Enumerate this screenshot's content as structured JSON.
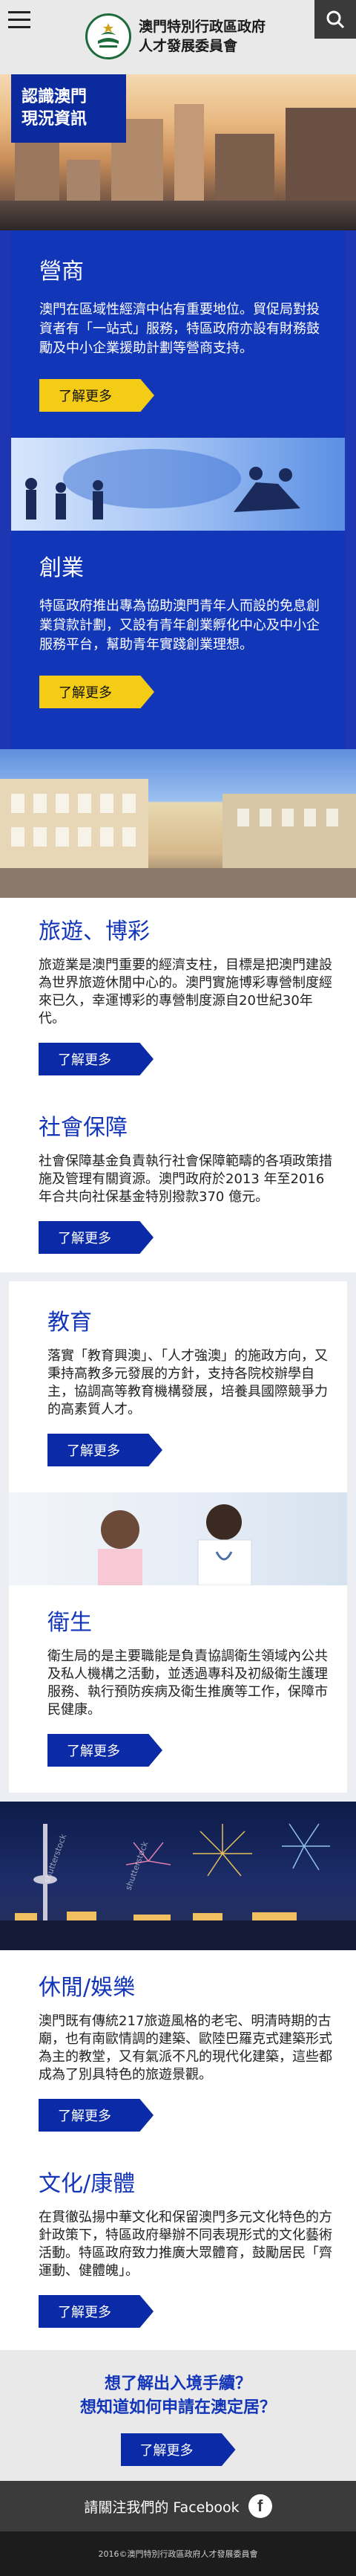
{
  "header": {
    "title_line1": "澳門特別行政區政府",
    "title_line2": "人才發展委員會"
  },
  "hero": {
    "label_line1": "認識澳門",
    "label_line2": "現況資訊"
  },
  "blue_sections": [
    {
      "title": "營商",
      "text": "澳門在區域性經濟中佔有重要地位。貿促局對投資者有「一站式」服務，特區政府亦設有財務鼓勵及中小企業援助計劃等營商支持。",
      "button": "了解更多"
    },
    {
      "title": "創業",
      "text": "特區政府推出專為協助澳門青年人而設的免息創業貸款計劃，又設有青年創業孵化中心及中小企服務平台，幫助青年實踐創業理想。",
      "button": "了解更多"
    }
  ],
  "white_sections_a": [
    {
      "title": "旅遊、博彩",
      "text": "旅遊業是澳門重要的經濟支柱，目標是把澳門建設為世界旅遊休閒中心的。澳門實施博彩專營制度經來已久，幸運博彩的專營制度源自20世紀30年代。",
      "button": "了解更多"
    },
    {
      "title": "社會保障",
      "text": "社會保障基金負責執行社會保障範疇的各項政策措施及管理有關資源。澳門政府於2013 年至2016 年合共向社保基金特別撥款370 億元。",
      "button": "了解更多"
    }
  ],
  "white_sections_b": [
    {
      "title": "教育",
      "text": "落實「教育興澳」、「人才強澳」的施政方向，又秉持高教多元發展的方針，支持各院校辦學自主，協調高等教育機構發展，培養具國際競爭力的高素質人才。",
      "button": "了解更多"
    },
    {
      "title": "衛生",
      "text": "衛生局的是主要職能是負責協調衛生領域內公共及私人機構之活動，並透過專科及初級衛生護理服務、執行預防疾病及衛生推廣等工作，保障市民健康。",
      "button": "了解更多"
    }
  ],
  "white_sections_c": [
    {
      "title": "休閒/娛樂",
      "text": "澳門既有傳統217旅遊風格的老宅、明清時期的古廟，也有南歐情調的建築、歐陸巴羅克式建築形式為主的教堂，又有氣派不凡的現代化建築，這些都成為了別具特色的旅遊景觀。",
      "button": "了解更多"
    },
    {
      "title": "文化/康體",
      "text": "在貫徹弘揚中華文化和保留澳門多元文化特色的方針政策下，特區政府舉辦不同表現形式的文化藝術活動。特區政府致力推廣大眾體育，鼓勵居民「齊運動、健體魄」。",
      "button": "了解更多"
    }
  ],
  "cta": {
    "line1": "想了解出入境手續？",
    "line2": "想知道如何申請在澳定居？",
    "button": "了解更多"
  },
  "facebook": {
    "label": "請關注我們的 Facebook",
    "glyph": "f"
  },
  "footer": {
    "text": "2016©澳門特別行政區政府人才發展委員會"
  },
  "watermarks": [
    "shutterstock",
    "shutterstock"
  ],
  "colors": {
    "primary_blue": "#1236b8",
    "navy_button": "#0a2aa8",
    "yellow_button": "#f5cc15",
    "footer_dark": "#1c1c1c"
  },
  "icons": [
    "menu-icon",
    "logo-seal-icon",
    "search-icon",
    "arrow-right-icon",
    "facebook-icon"
  ]
}
